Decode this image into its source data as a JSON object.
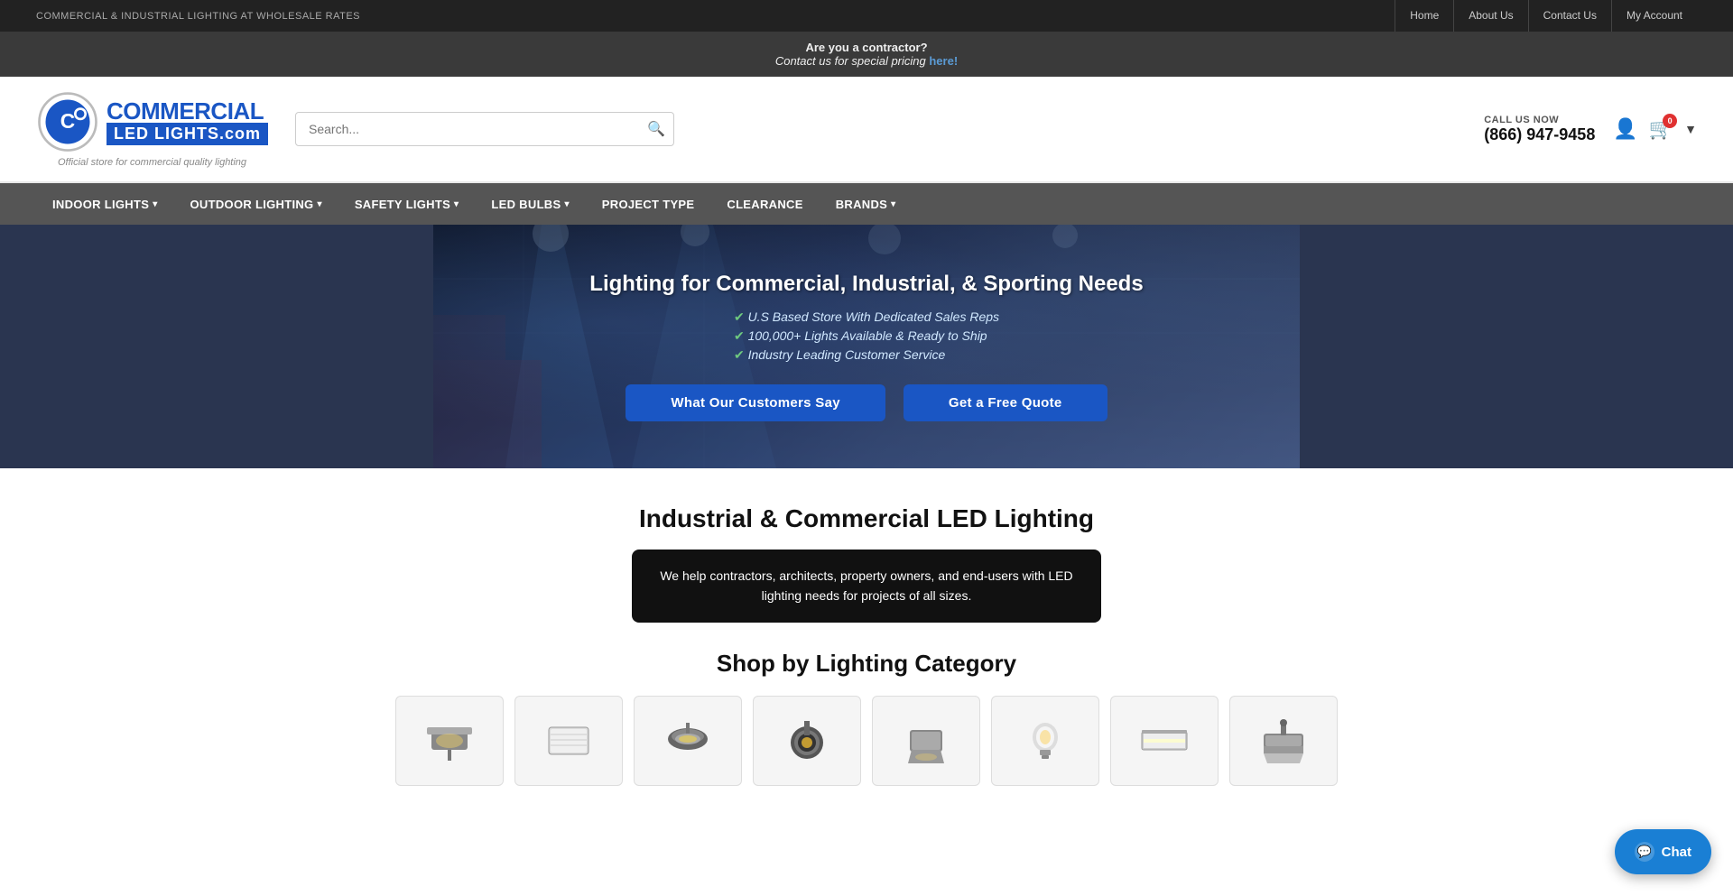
{
  "topbar": {
    "left_text": "COMMERCIAL & INDUSTRIAL LIGHTING AT WHOLESALE RATES",
    "nav_items": [
      {
        "label": "Home",
        "id": "home"
      },
      {
        "label": "About Us",
        "id": "about"
      },
      {
        "label": "Contact Us",
        "id": "contact"
      },
      {
        "label": "My Account",
        "id": "account"
      }
    ]
  },
  "contractor_banner": {
    "main_text": "Are you a contractor?",
    "sub_text": "Contact us for special pricing ",
    "link_text": "here!"
  },
  "header": {
    "logo_top": "COMMERCIAL",
    "logo_bottom": "LED LIGHTS.com",
    "logo_subtitle": "Official store for commercial quality lighting",
    "search_placeholder": "Search...",
    "call_label": "CALL US NOW",
    "call_number": "(866) 947-9458",
    "cart_count": "0"
  },
  "nav": {
    "items": [
      {
        "label": "INDOOR LIGHTS",
        "has_dropdown": true
      },
      {
        "label": "OUTDOOR LIGHTING",
        "has_dropdown": true
      },
      {
        "label": "SAFETY LIGHTS",
        "has_dropdown": true
      },
      {
        "label": "LED BULBS",
        "has_dropdown": true
      },
      {
        "label": "PROJECT TYPE",
        "has_dropdown": false
      },
      {
        "label": "CLEARANCE",
        "has_dropdown": false
      },
      {
        "label": "BRANDS",
        "has_dropdown": true
      }
    ]
  },
  "hero": {
    "title": "Lighting for Commercial, Industrial, & Sporting Needs",
    "bullets": [
      "U.S Based Store With Dedicated Sales Reps",
      "100,000+ Lights Available & Ready to Ship",
      "Industry Leading Customer Service"
    ],
    "btn1": "What Our Customers Say",
    "btn2": "Get a Free Quote"
  },
  "below_hero": {
    "title": "Industrial & Commercial LED Lighting",
    "description": "We help contractors, architects, property owners, and end-users with LED lighting needs for projects of all sizes.",
    "category_title": "Shop by Lighting Category"
  },
  "chat": {
    "label": "Chat"
  }
}
